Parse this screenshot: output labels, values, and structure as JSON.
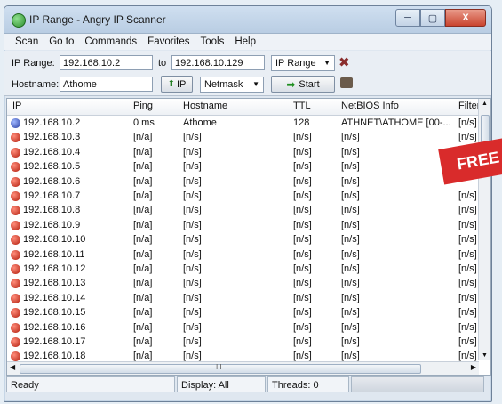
{
  "window": {
    "title": "IP Range - Angry IP Scanner",
    "controls": [
      "─",
      "▢",
      "X"
    ]
  },
  "menu": [
    "Scan",
    "Go to",
    "Commands",
    "Favorites",
    "Tools",
    "Help"
  ],
  "toolbar": {
    "ip_range_label": "IP Range:",
    "from_value": "192.168.10.2",
    "to_label": "to",
    "to_value": "192.168.10.129",
    "feeder_select": "IP Range",
    "hostname_label": "Hostname:",
    "hostname_value": "Athome",
    "ip_button": "IP",
    "netmask_select": "Netmask",
    "start_button": "Start"
  },
  "table": {
    "columns": [
      "IP",
      "Ping",
      "Hostname",
      "TTL",
      "NetBIOS Info",
      "Filtered"
    ],
    "rows": [
      {
        "ip": "192.168.10.2",
        "ping": "0 ms",
        "hostname": "Athome",
        "ttl": "128",
        "netbios": "ATHNET\\ATHOME [00-...",
        "filtered": "[n/s]",
        "status": "alive"
      },
      {
        "ip": "192.168.10.3",
        "ping": "[n/a]",
        "hostname": "[n/s]",
        "ttl": "[n/s]",
        "netbios": "[n/s]",
        "filtered": "[n/s]",
        "status": "dead"
      },
      {
        "ip": "192.168.10.4",
        "ping": "[n/a]",
        "hostname": "[n/s]",
        "ttl": "[n/s]",
        "netbios": "[n/s]",
        "filtered": "",
        "status": "dead"
      },
      {
        "ip": "192.168.10.5",
        "ping": "[n/a]",
        "hostname": "[n/s]",
        "ttl": "[n/s]",
        "netbios": "[n/s]",
        "filtered": "",
        "status": "dead"
      },
      {
        "ip": "192.168.10.6",
        "ping": "[n/a]",
        "hostname": "[n/s]",
        "ttl": "[n/s]",
        "netbios": "[n/s]",
        "filtered": "",
        "status": "dead"
      },
      {
        "ip": "192.168.10.7",
        "ping": "[n/a]",
        "hostname": "[n/s]",
        "ttl": "[n/s]",
        "netbios": "[n/s]",
        "filtered": "[n/s]",
        "status": "dead"
      },
      {
        "ip": "192.168.10.8",
        "ping": "[n/a]",
        "hostname": "[n/s]",
        "ttl": "[n/s]",
        "netbios": "[n/s]",
        "filtered": "[n/s]",
        "status": "dead"
      },
      {
        "ip": "192.168.10.9",
        "ping": "[n/a]",
        "hostname": "[n/s]",
        "ttl": "[n/s]",
        "netbios": "[n/s]",
        "filtered": "[n/s]",
        "status": "dead"
      },
      {
        "ip": "192.168.10.10",
        "ping": "[n/a]",
        "hostname": "[n/s]",
        "ttl": "[n/s]",
        "netbios": "[n/s]",
        "filtered": "[n/s]",
        "status": "dead"
      },
      {
        "ip": "192.168.10.11",
        "ping": "[n/a]",
        "hostname": "[n/s]",
        "ttl": "[n/s]",
        "netbios": "[n/s]",
        "filtered": "[n/s]",
        "status": "dead"
      },
      {
        "ip": "192.168.10.12",
        "ping": "[n/a]",
        "hostname": "[n/s]",
        "ttl": "[n/s]",
        "netbios": "[n/s]",
        "filtered": "[n/s]",
        "status": "dead"
      },
      {
        "ip": "192.168.10.13",
        "ping": "[n/a]",
        "hostname": "[n/s]",
        "ttl": "[n/s]",
        "netbios": "[n/s]",
        "filtered": "[n/s]",
        "status": "dead"
      },
      {
        "ip": "192.168.10.14",
        "ping": "[n/a]",
        "hostname": "[n/s]",
        "ttl": "[n/s]",
        "netbios": "[n/s]",
        "filtered": "[n/s]",
        "status": "dead"
      },
      {
        "ip": "192.168.10.15",
        "ping": "[n/a]",
        "hostname": "[n/s]",
        "ttl": "[n/s]",
        "netbios": "[n/s]",
        "filtered": "[n/s]",
        "status": "dead"
      },
      {
        "ip": "192.168.10.16",
        "ping": "[n/a]",
        "hostname": "[n/s]",
        "ttl": "[n/s]",
        "netbios": "[n/s]",
        "filtered": "[n/s]",
        "status": "dead"
      },
      {
        "ip": "192.168.10.17",
        "ping": "[n/a]",
        "hostname": "[n/s]",
        "ttl": "[n/s]",
        "netbios": "[n/s]",
        "filtered": "[n/s]",
        "status": "dead"
      },
      {
        "ip": "192.168.10.18",
        "ping": "[n/a]",
        "hostname": "[n/s]",
        "ttl": "[n/s]",
        "netbios": "[n/s]",
        "filtered": "[n/s]",
        "status": "dead"
      }
    ]
  },
  "scrollbar": {
    "h_thumb_label": "III"
  },
  "status": {
    "text": "Ready",
    "display": "Display: All",
    "threads": "Threads: 0"
  },
  "badge": {
    "text": "FREE"
  },
  "colors": {
    "alive": "#2b3fa8",
    "dead": "#c0200f",
    "badge": "#d92b2b"
  }
}
